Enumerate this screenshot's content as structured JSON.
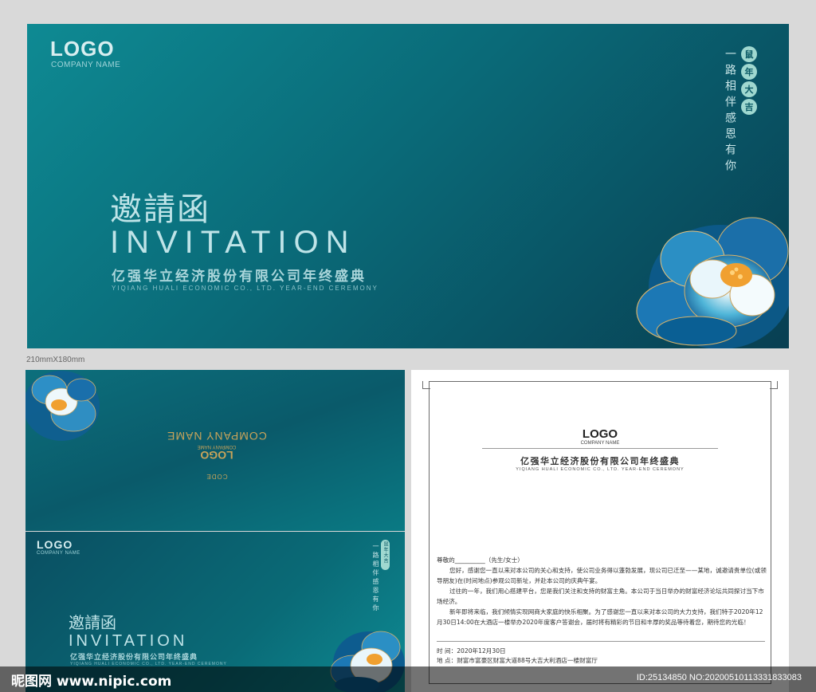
{
  "cover": {
    "logo": "LOGO",
    "company_name": "COMPANY NAME",
    "title_cn": "邀請函",
    "title_en": "INVITATION",
    "subtitle_cn": "亿强华立经济股份有限公司年终盛典",
    "subtitle_en": "YIQIANG HUALI ECONOMIC CO., LTD. YEAR-END CEREMONY",
    "vertical_text": "一路相伴感恩有你",
    "badge_chars": [
      "鼠",
      "年",
      "大",
      "吉"
    ]
  },
  "size_label": "210mmX180mm",
  "back": {
    "logo": "LOGO",
    "company_name": "COMPANY NAME",
    "code_text": "CODE"
  },
  "front": {
    "logo": "LOGO",
    "company_name": "COMPANY NAME",
    "title_cn": "邀請函",
    "title_en": "INVITATION",
    "subtitle_cn": "亿强华立经济股份有限公司年终盛典",
    "subtitle_en": "YIQIANG HUALI ECONOMIC CO., LTD. YEAR-END CEREMONY",
    "vertical_text": "一路相伴感恩有你",
    "badge_text": "鼠年大吉"
  },
  "inner": {
    "logo": "LOGO",
    "company_name": "COMPANY NAME",
    "title_cn": "亿强华立经济股份有限公司年终盛典",
    "title_en": "YIQIANG HUALI ECONOMIC CO., LTD. YEAR-END CEREMONY",
    "greeting": "尊敬的__________（先生/女士）",
    "para1": "您好，感谢您一直以来对本公司的关心和支持，使公司业务得以蓬勃发展，现公司已迁至——某地，诚邀请贵单位(或领导朋友)在(时间地点)参观公司新址，并赴本公司的庆典午宴。",
    "para2": "过往的一年，我们用心搭建平台，您是我们关注和支持的财富主角。本公司于当日举办的财富经济论坛共同探讨当下市场经济。",
    "para3": "新年即将来临，我们倾情实现网商大家庭的快乐相聚。为了感谢您一直以来对本公司的大力支持，我们特于2020年12月30日14:00在大酒店一楼举办2020年度客户答谢会，届时将有精彩的节目和丰厚的奖品等待着您，期待您的光临！",
    "time": "时  间：2020年12月30日",
    "place": "地  点：财富市富豪区财富大道88号大吉大利酒店一楼财富厅"
  },
  "watermark": {
    "left": "昵图网 www.nipic.com",
    "right": "ID:25134850 NO:20200510113331833083"
  }
}
